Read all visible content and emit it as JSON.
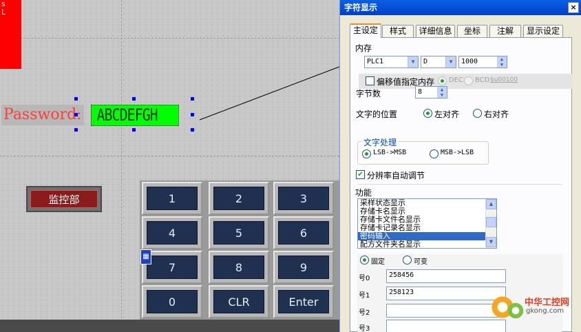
{
  "canvas": {
    "red_block_text": "s\nL",
    "password_label": "Password:",
    "char_display_value": "ABCDEFGH",
    "monitor_button_label": "监控部",
    "keypad": [
      [
        "1",
        "2",
        "3"
      ],
      [
        "4",
        "5",
        "6"
      ],
      [
        "7",
        "8",
        "9"
      ],
      [
        "0",
        "CLR",
        "Enter"
      ]
    ],
    "calc_icon": "calculator-icon"
  },
  "dialog": {
    "title": "字符显示",
    "close": "×",
    "tabs": [
      "主设定",
      "样式",
      "详细信息",
      "坐标",
      "注解",
      "显示设定"
    ],
    "memory_label": "内存",
    "memory_plc": "PLC1",
    "memory_device": "D",
    "memory_address": "1000",
    "offset_checkbox_label": "偏移值指定内存",
    "offset_dec": "DEC",
    "offset_bcd": "BCD",
    "offset_address": "$u00100",
    "byte_count_label": "字节数",
    "byte_count": "8",
    "text_position_label": "文字的位置",
    "align_left": "左对齐",
    "align_right": "右对齐",
    "text_processing_label": "文字处理",
    "lsb_msb": "LSB->MSB",
    "msb_lsb": "MSB->LSB",
    "auto_resolution_label": "分辨率自动调节",
    "function_label": "功能",
    "function_items": [
      "采样状态显示",
      "存储卡名显示",
      "存储卡文件名显示",
      "存储卡记录名显示",
      "密码输入",
      "配方文件夹名显示"
    ],
    "selected_function": "密码输入",
    "mode_fixed": "固定",
    "mode_variable": "可变",
    "passwords": [
      {
        "label": "号0",
        "value": "258456"
      },
      {
        "label": "号1",
        "value": "258123"
      },
      {
        "label": "号2",
        "value": ""
      },
      {
        "label": "号3",
        "value": ""
      }
    ]
  },
  "watermark": {
    "cn": "中华工控网",
    "en": "gkong.com"
  }
}
